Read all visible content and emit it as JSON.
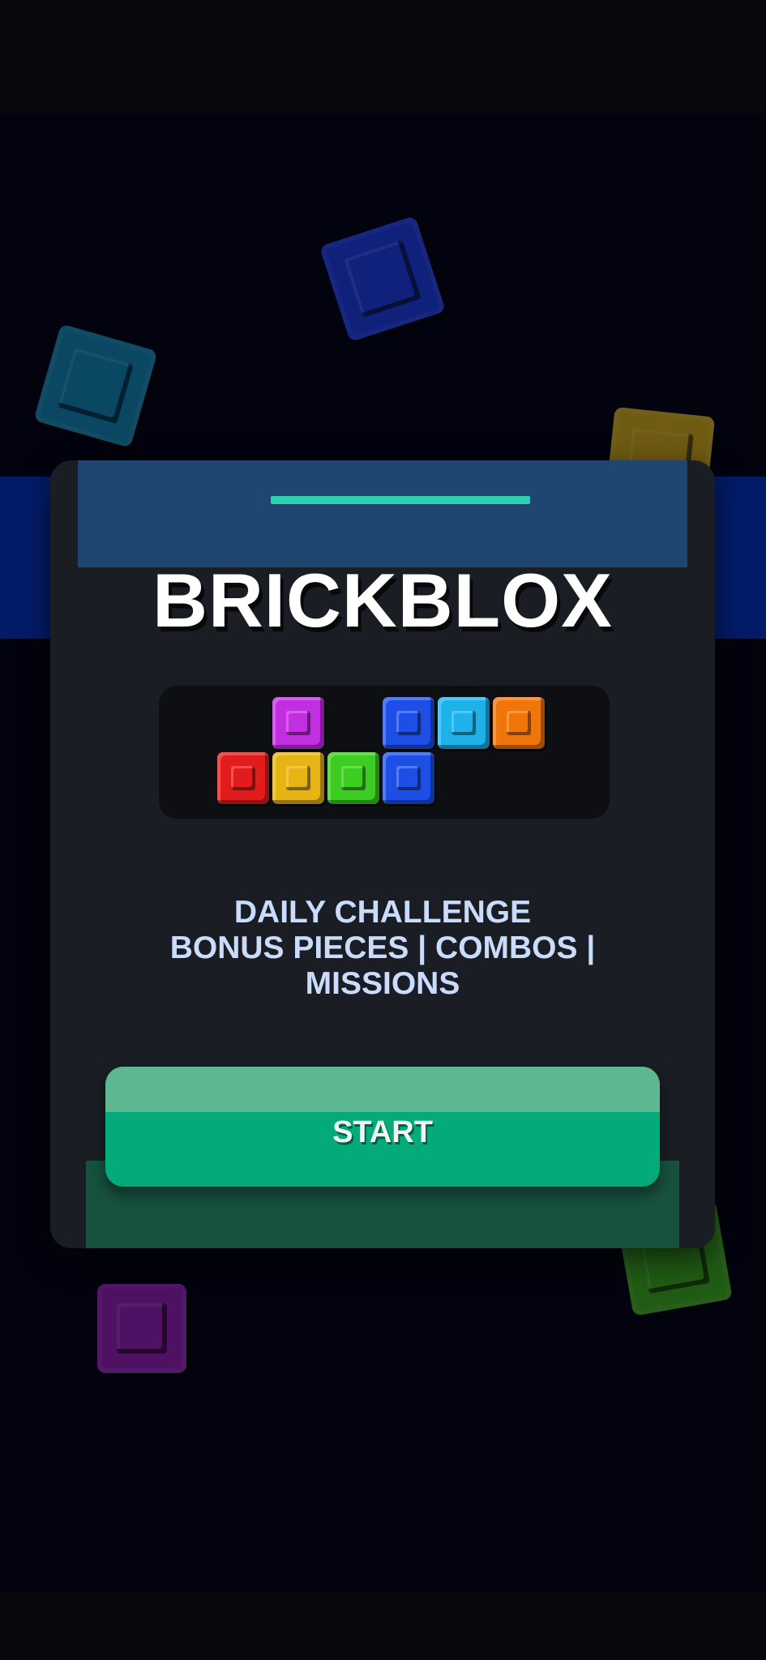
{
  "game": {
    "title": "BRICKBLOX",
    "tagline_lines": [
      "DAILY CHALLENGE",
      "BONUS PIECES | COMBOS |",
      "MISSIONS"
    ],
    "start_label": "START"
  },
  "colors": {
    "background": "#03030f",
    "band": "#031c6a",
    "card": "#1a1d23",
    "card_header": "#1f4571",
    "header_accent": "#2fd1b3",
    "tagline": "#c9dcfb",
    "start_button": "#04aa7a",
    "start_button_top": "#5db790",
    "start_base": "#17523f"
  },
  "preview_blocks": [
    {
      "name": "purple-block",
      "color": "#c22fe0"
    },
    {
      "name": "blue-block",
      "color": "#1d4fe6"
    },
    {
      "name": "cyan-block",
      "color": "#1fb2ea"
    },
    {
      "name": "orange-block",
      "color": "#f0760c"
    },
    {
      "name": "red-block",
      "color": "#e21c1c"
    },
    {
      "name": "yellow-block",
      "color": "#e7b416"
    },
    {
      "name": "green-block",
      "color": "#3ccc22"
    },
    {
      "name": "blue-block",
      "color": "#1d4fe6"
    }
  ],
  "decor_blocks": [
    {
      "name": "floating-blue-block",
      "color": "#1b3bd6"
    },
    {
      "name": "floating-teal-block",
      "color": "#0f7fa6"
    },
    {
      "name": "floating-gold-block",
      "color": "#c9a417"
    },
    {
      "name": "floating-green-block",
      "color": "#3aa519"
    },
    {
      "name": "floating-purple-block",
      "color": "#8e1ea9"
    }
  ]
}
